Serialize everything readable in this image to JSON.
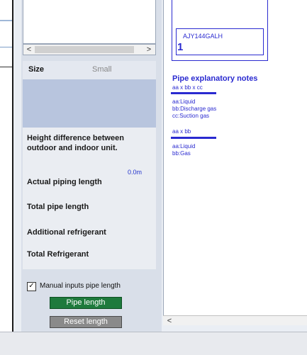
{
  "preview": {
    "scroll_left": "<",
    "scroll_right": ">"
  },
  "size": {
    "label": "Size",
    "value": "Small"
  },
  "params": {
    "height_diff_label": "Height difference between outdoor and indoor unit.",
    "height_diff_value": "0.0m",
    "actual_piping_label": "Actual piping length",
    "total_pipe_label": "Total pipe length",
    "additional_refrigerant_label": "Additional refrigerant",
    "total_refrigerant_label": "Total Refrigerant"
  },
  "manual_inputs": {
    "checked": true,
    "check_mark": "✓",
    "label": "Manual inputs pipe length"
  },
  "buttons": {
    "pipe_length": "Pipe length",
    "reset_length": "Reset length"
  },
  "drawing": {
    "model_name": "AJY144GALH",
    "unit_count": "1",
    "notes_title": "Pipe explanatory notes",
    "group1_header": "aa x bb x cc",
    "group1_items": [
      "aa:Liquid",
      "bb:Discharge gas",
      "cc:Suction gas"
    ],
    "group2_header": "aa x bb",
    "group2_items": [
      "aa:Liquid",
      "bb:Gas"
    ],
    "scroll_left": "<"
  },
  "colors": {
    "accent_blue": "#2a2ad0",
    "pipe_button": "#1e7a3c",
    "reset_button": "#8a8a8a"
  }
}
